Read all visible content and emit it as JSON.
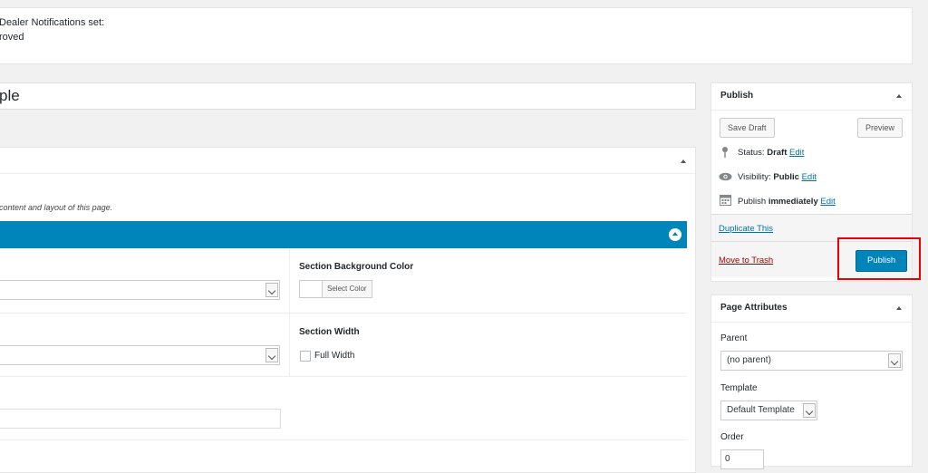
{
  "notice": {
    "line1": "Dealer Notifications set:",
    "line2": "roved"
  },
  "title": {
    "value": "ple"
  },
  "builder": {
    "description": "content and layout of this page.",
    "section_bg_label": "Section Background Color",
    "select_color_label": "Select Color",
    "section_width_label": "Section Width",
    "full_width_label": "Full Width"
  },
  "publish": {
    "title": "Publish",
    "save_draft": "Save Draft",
    "preview": "Preview",
    "status_label": "Status: ",
    "status_value": "Draft",
    "visibility_label": "Visibility: ",
    "visibility_value": "Public",
    "publish_label": "Publish ",
    "publish_value": "immediately",
    "edit": "Edit",
    "duplicate": "Duplicate This",
    "trash": "Move to Trash",
    "publish_button": "Publish"
  },
  "page_attributes": {
    "title": "Page Attributes",
    "parent_label": "Parent",
    "parent_value": "(no parent)",
    "template_label": "Template",
    "template_value": "Default Template",
    "order_label": "Order",
    "order_value": "0"
  },
  "colors": {
    "primary": "#0085ba",
    "link": "#0073aa",
    "trash": "#a00",
    "highlight": "#e00"
  },
  "icons": {
    "status": "pin-icon",
    "visibility": "eye-icon",
    "calendar": "calendar-icon"
  }
}
